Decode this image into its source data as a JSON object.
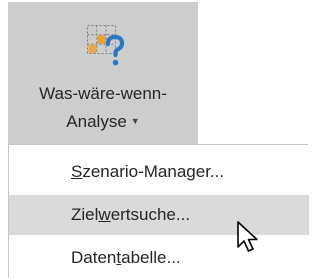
{
  "ribbon": {
    "button_line1": "Was-wäre-wenn-",
    "button_line2": "Analyse",
    "icon": "what-if-analysis-icon",
    "dropdown_icon": "caret-down-icon"
  },
  "menu": {
    "items": [
      {
        "pre": "",
        "accel": "S",
        "post": "zenario-Manager...",
        "state": "normal"
      },
      {
        "pre": "Ziel",
        "accel": "w",
        "post": "ertsuche...",
        "state": "hover"
      },
      {
        "pre": "Daten",
        "accel": "t",
        "post": "abelle...",
        "state": "normal"
      }
    ]
  },
  "colors": {
    "ribbon_pressed": "#cdcdcd",
    "menu_hover": "#dadada",
    "icon_orange": "#f0a030",
    "icon_blue": "#2b78c6",
    "text": "#262626"
  },
  "cursor": "arrow-pointer-icon"
}
